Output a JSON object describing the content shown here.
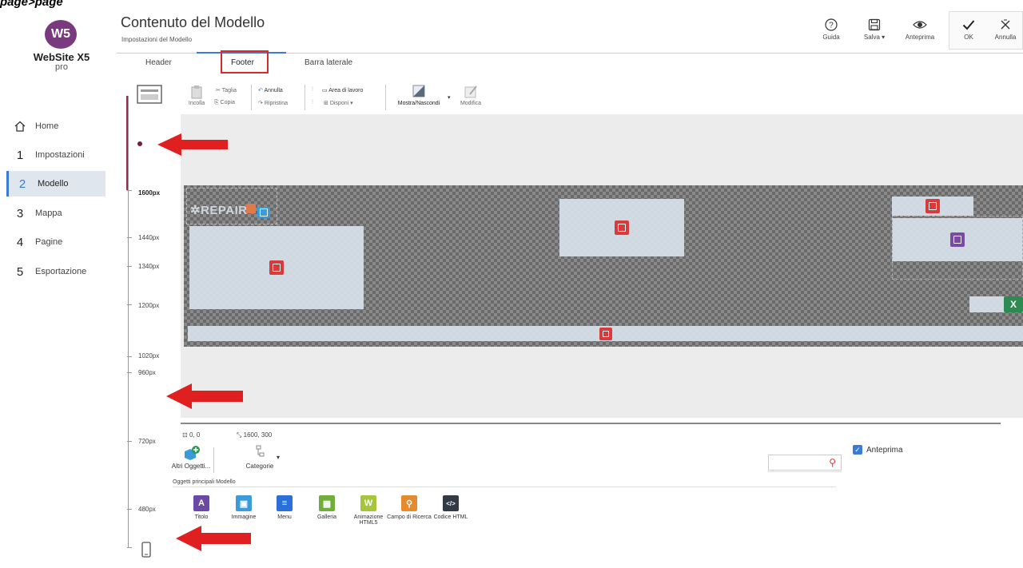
{
  "caption": "page>page",
  "app": {
    "logo_mark": "W5",
    "name": "WebSite X5",
    "edition": "pro"
  },
  "nav": {
    "home": "Home",
    "items": [
      {
        "num": "1",
        "label": "Impostazioni"
      },
      {
        "num": "2",
        "label": "Modello"
      },
      {
        "num": "3",
        "label": "Mappa"
      },
      {
        "num": "4",
        "label": "Pagine"
      },
      {
        "num": "5",
        "label": "Esportazione"
      }
    ]
  },
  "header": {
    "title": "Contenuto del Modello",
    "subtitle": "Impostazioni del Modello",
    "buttons": {
      "help": "Guida",
      "save": "Salva ▾",
      "preview": "Anteprima",
      "ok": "OK",
      "cancel": "Annulla"
    }
  },
  "tabs": [
    "Header",
    "Footer",
    "Barra laterale"
  ],
  "ruler": {
    "labels": [
      "1600px",
      "1440px",
      "1340px",
      "1200px",
      "1020px",
      "960px",
      "720px",
      "480px"
    ]
  },
  "toolbar": {
    "paste": "Incolla",
    "cut": "Taglia",
    "copy": "Copia",
    "undo": "Annulla",
    "redo": "Ripristina",
    "work_area": "Area di lavoro",
    "arrange": "Disponi ▾",
    "show_hide": "Mostra/Nascondi",
    "edit": "Modifica"
  },
  "canvas": {
    "logo_text": "REPAIR"
  },
  "status": {
    "position": "0, 0",
    "size": "1600, 300"
  },
  "bottom": {
    "other_objects": "Altri Oggetti...",
    "categories": "Categorie",
    "preview_label": "Anteprima",
    "section_title": "Oggetti principali Modello",
    "palette": [
      {
        "label": "Titolo",
        "glyph": "A",
        "color": "#6a4aa5"
      },
      {
        "label": "Immagine",
        "glyph": "▣",
        "color": "#3b9ad8"
      },
      {
        "label": "Menu",
        "glyph": "≡",
        "color": "#2d6fd8"
      },
      {
        "label": "Galleria",
        "glyph": "▦",
        "color": "#6fae3b"
      },
      {
        "label": "Animazione HTML5",
        "glyph": "W",
        "color": "#a6c53b"
      },
      {
        "label": "Campo di Ricerca",
        "glyph": "⚲",
        "color": "#e58a2d"
      },
      {
        "label": "Codice HTML",
        "glyph": "</>",
        "color": "#333a44"
      }
    ]
  },
  "colors": {
    "accent": "#3a7bd5",
    "highlight_red": "#d62b2b",
    "arrow_red": "#e02020",
    "ruler_accent": "#9a2a4e"
  }
}
